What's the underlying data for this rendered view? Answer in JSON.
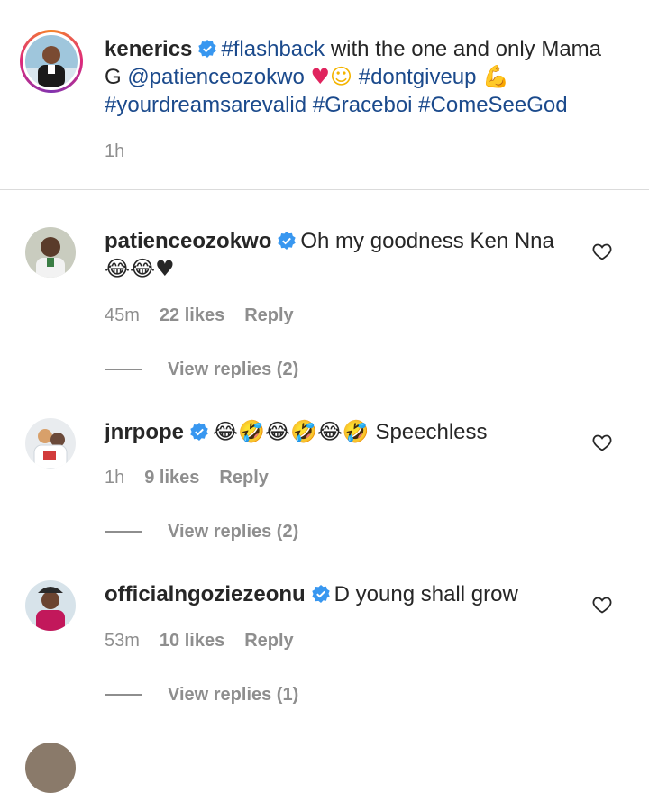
{
  "caption": {
    "username": "kenerics",
    "segments": [
      {
        "text": "#flashback",
        "link": true
      },
      {
        "text": " with the one and only Mama G ",
        "link": false
      },
      {
        "text": "@patienceozokwo",
        "link": true
      }
    ],
    "emoji_1": "♥",
    "emoji_2": "☺",
    "tag_dontgiveup": "#dontgiveup",
    "emoji_3": "💪",
    "line3_tags": "#yourdreamsarevalid #Graceboi #ComeSeeGod",
    "time": "1h"
  },
  "comments": [
    {
      "username": "patienceozokwo",
      "text_line1": "Oh my goodness Ken Nna",
      "emoji_line": "😂😂♥",
      "time": "45m",
      "likes": "22 likes",
      "reply": "Reply",
      "view_replies": "View replies (2)"
    },
    {
      "username": "jnrpope",
      "emoji_line": "😂🤣😂🤣😂🤣",
      "text": "Speechless",
      "time": "1h",
      "likes": "9 likes",
      "reply": "Reply",
      "view_replies": "View replies (2)"
    },
    {
      "username": "officialngoziezeonu",
      "text": "D young shall grow",
      "time": "53m",
      "likes": "10 likes",
      "reply": "Reply",
      "view_replies": "View replies (1)"
    }
  ],
  "colors": {
    "link": "#1b4a8c",
    "verified": "#3897f0",
    "meta": "#8e8e8e",
    "heart": "#e0245e"
  },
  "icons": [
    "verified-badge-icon",
    "heart-outline-icon"
  ]
}
